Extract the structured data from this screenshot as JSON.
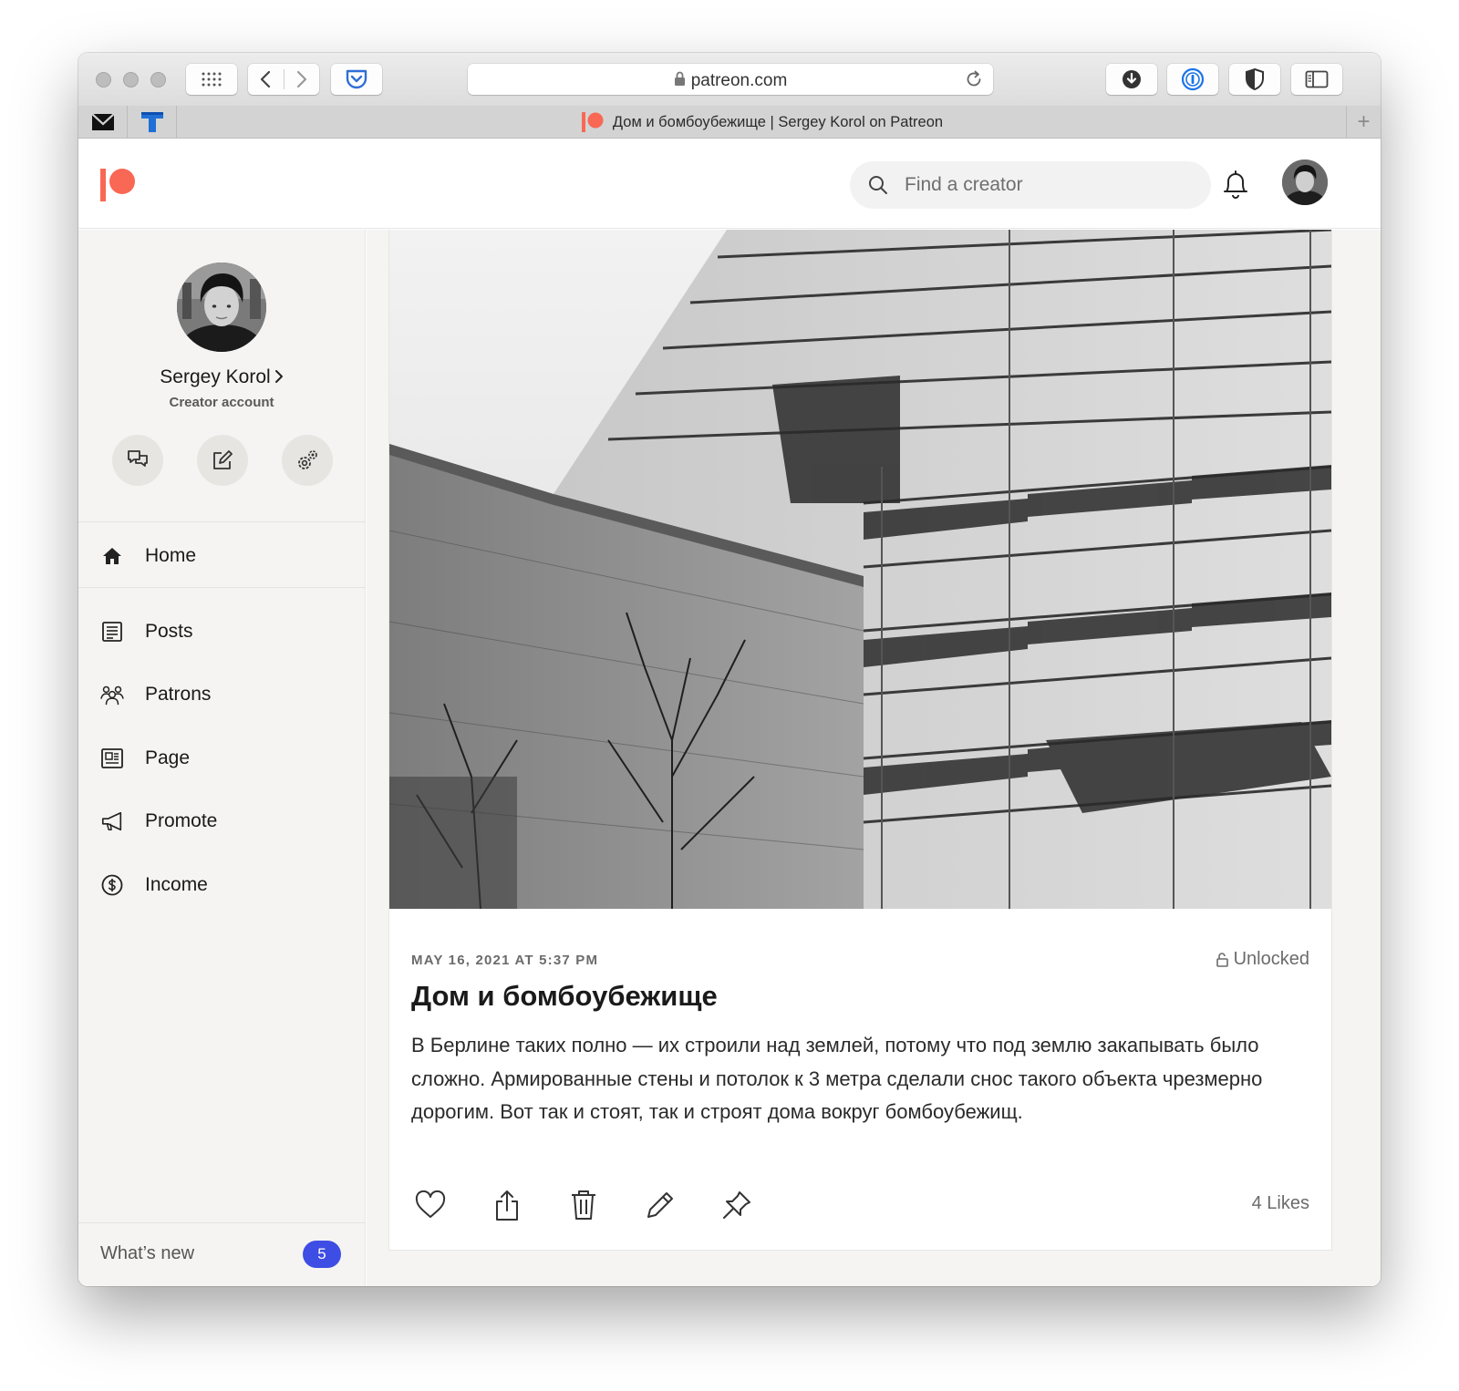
{
  "browser": {
    "url": "patreon.com",
    "tab_title": "Дом и бомбоубежище | Sergey Korol on Patreon",
    "new_tab_symbol": "+",
    "icons": [
      "grid-icon",
      "back-icon",
      "forward-icon",
      "pocket-icon",
      "lock-icon",
      "reload-icon",
      "download-icon",
      "password-manager-icon",
      "shield-icon",
      "sidebar-icon",
      "mail-icon",
      "t-icon"
    ]
  },
  "header": {
    "search_placeholder": "Find a creator",
    "brand_color": "#f96854"
  },
  "sidebar": {
    "name": "Sergey Korol",
    "account_type": "Creator account",
    "actions": [
      "messages-icon",
      "edit-icon",
      "settings-icon"
    ],
    "nav": [
      {
        "label": "Home",
        "icon": "home-icon",
        "active": true
      },
      {
        "label": "Posts",
        "icon": "posts-icon"
      },
      {
        "label": "Patrons",
        "icon": "patrons-icon"
      },
      {
        "label": "Page",
        "icon": "page-icon"
      },
      {
        "label": "Promote",
        "icon": "megaphone-icon"
      },
      {
        "label": "Income",
        "icon": "dollar-icon"
      }
    ],
    "whats_new": {
      "label": "What’s new",
      "count": "5",
      "badge_color": "#3e4de3"
    }
  },
  "post": {
    "date": "MAY 16, 2021 AT 5:37 PM",
    "access": "Unlocked",
    "title": "Дом и бомбоубежище",
    "body": "В Берлине таких полно — их строили над землей, потому что под землю закапывать было сложно. Армированные стены и потолок к 3 метра сделали снос такого объекта чрезмерно дорогим. Вот так и стоят, так и строят дома вокруг бомбоубежищ.",
    "actions": [
      "like-icon",
      "share-icon",
      "delete-icon",
      "edit-icon",
      "pin-icon"
    ],
    "likes": "4 Likes"
  }
}
